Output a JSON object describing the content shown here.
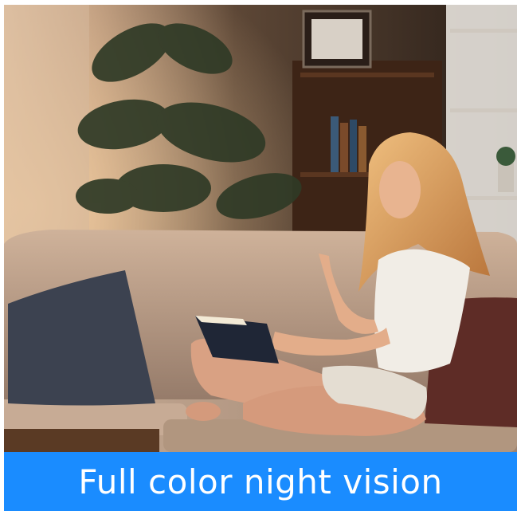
{
  "banner": {
    "caption": "Full color night vision",
    "background_color": "#1a8cff",
    "text_color": "#ffffff"
  },
  "scene": {
    "palette": {
      "wall": "#3a2c22",
      "sofa": "#b89a82",
      "lamp_glow": "#ffd59a",
      "shelf": "#4a2c1c",
      "floor_table": "#5a3a24"
    }
  }
}
